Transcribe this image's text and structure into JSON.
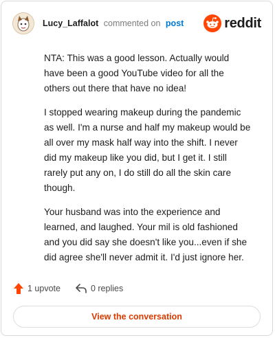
{
  "header": {
    "username": "Lucy_Laffalot",
    "action_text": "commented on",
    "post_link": "post",
    "brand": "reddit"
  },
  "comment": {
    "paragraphs": [
      "NTA: This was a good lesson. Actually would have been a good YouTube video for all the others out there that have no idea!",
      "I stopped wearing makeup during the pandemic as well. I'm a nurse and half my makeup would be all over my mask half way into the shift. I never did my makeup like you did, but I get it. I still rarely put any on, I do still do all the skin care though.",
      "Your husband was into the experience and learned, and laughed. Your mil is old fashioned and you did say she doesn't like you...even if she did agree she'll never admit it. I'd just ignore her."
    ]
  },
  "footer": {
    "upvote_label": "1 upvote",
    "replies_label": "0 replies"
  },
  "cta": {
    "label": "View the conversation"
  },
  "colors": {
    "brand_orange": "#ff4500",
    "link_blue": "#0079d3",
    "cta_text": "#d93a00"
  },
  "icons": [
    "avatar",
    "reddit-logo-icon",
    "upvote-arrow-icon",
    "reply-arrow-icon"
  ]
}
